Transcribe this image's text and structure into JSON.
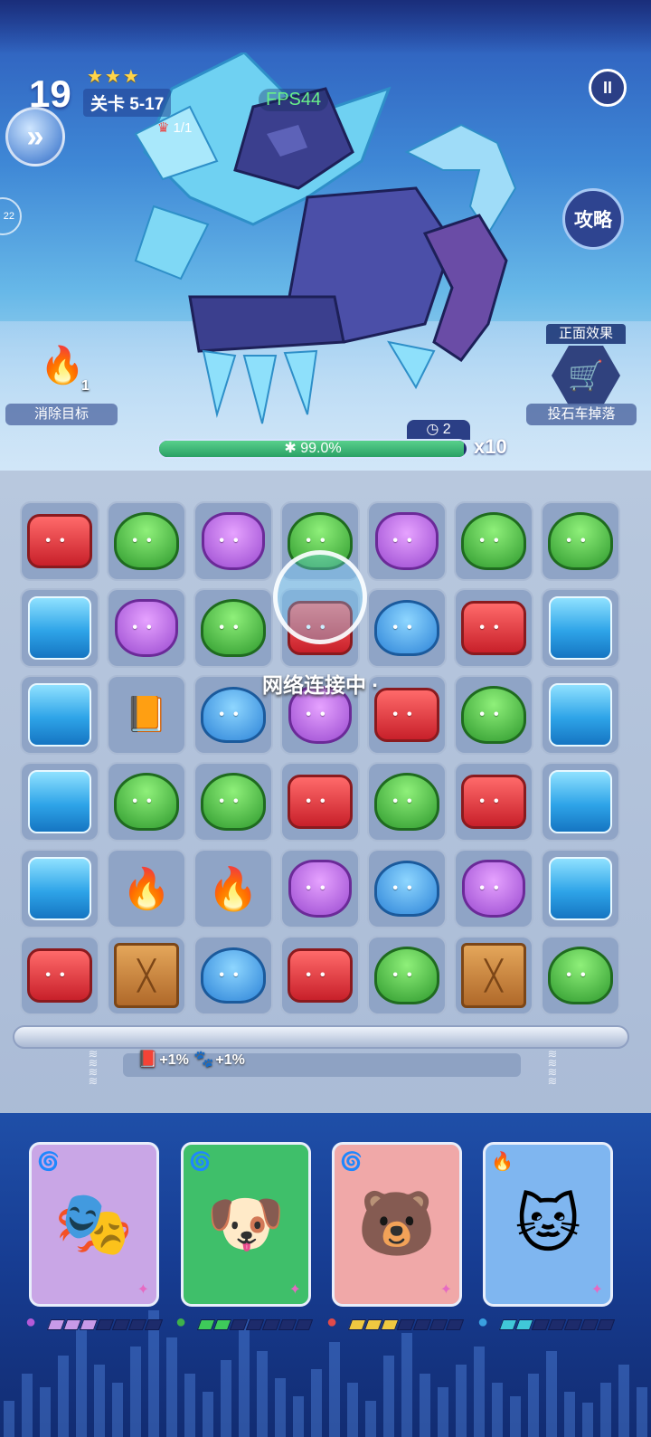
{
  "hud": {
    "level_number": "19",
    "stars": "★★★",
    "level_label": "关卡 5-17",
    "objective_progress": "1/1",
    "skip_glyph": "»",
    "side_tag": "22",
    "fps": "FPS44",
    "pause_glyph": "II",
    "guide_label": "攻略"
  },
  "goal": {
    "icon": "campfire-icon",
    "count": "1",
    "label": "消除目标"
  },
  "buff": {
    "title": "正面效果",
    "icon": "catapult-icon",
    "label": "投石车掉落"
  },
  "boss": {
    "moves_left": "2",
    "hp_text": "99.0%",
    "hp_fraction": 0.99,
    "multiplier": "x10"
  },
  "loading": {
    "text": "网络连接中 ·"
  },
  "board": {
    "rows": [
      [
        "red",
        "green",
        "purple",
        "green",
        "purple",
        "green",
        "green"
      ],
      [
        "ice",
        "purple",
        "green",
        "red",
        "blue",
        "red",
        "ice"
      ],
      [
        "ice",
        "book",
        "blue",
        "purple",
        "red",
        "green",
        "ice"
      ],
      [
        "ice",
        "green",
        "green",
        "red",
        "green",
        "red",
        "ice"
      ],
      [
        "ice",
        "campfire",
        "flame",
        "purple",
        "blue",
        "purple",
        "ice"
      ],
      [
        "red",
        "crate",
        "blue",
        "red",
        "green",
        "crate",
        "green"
      ]
    ]
  },
  "bonuses": [
    {
      "icon": "book-icon",
      "text": "+1%"
    },
    {
      "icon": "paw-icon",
      "text": "+1%"
    }
  ],
  "heroes": [
    {
      "name_icon": "opera-warrior-portrait",
      "element": "wind-swirl-icon",
      "bg": "#c9a6e6",
      "energy": 3,
      "gem_color": "#b45ad8"
    },
    {
      "name_icon": "pilot-dog-portrait",
      "element": "wind-swirl-icon",
      "bg": "#3fbf6a",
      "energy": 2,
      "gem_color": "#3eb04a"
    },
    {
      "name_icon": "astronaut-bear-portrait",
      "element": "wind-swirl-icon",
      "bg": "#f0a8a8",
      "energy": 3,
      "gem_color": "#e04a4a"
    },
    {
      "name_icon": "wizard-cat-portrait",
      "element": "fire-icon",
      "bg": "#7fb6f0",
      "energy": 2,
      "gem_color": "#3aa0e0"
    }
  ],
  "colors": {
    "hp_fill": "#2aa066",
    "energy_on_purple": "#c89ae8",
    "energy_on_green": "#3ecb5a",
    "energy_on_red": "#f0c840",
    "energy_on_cyan": "#40c8d8"
  }
}
